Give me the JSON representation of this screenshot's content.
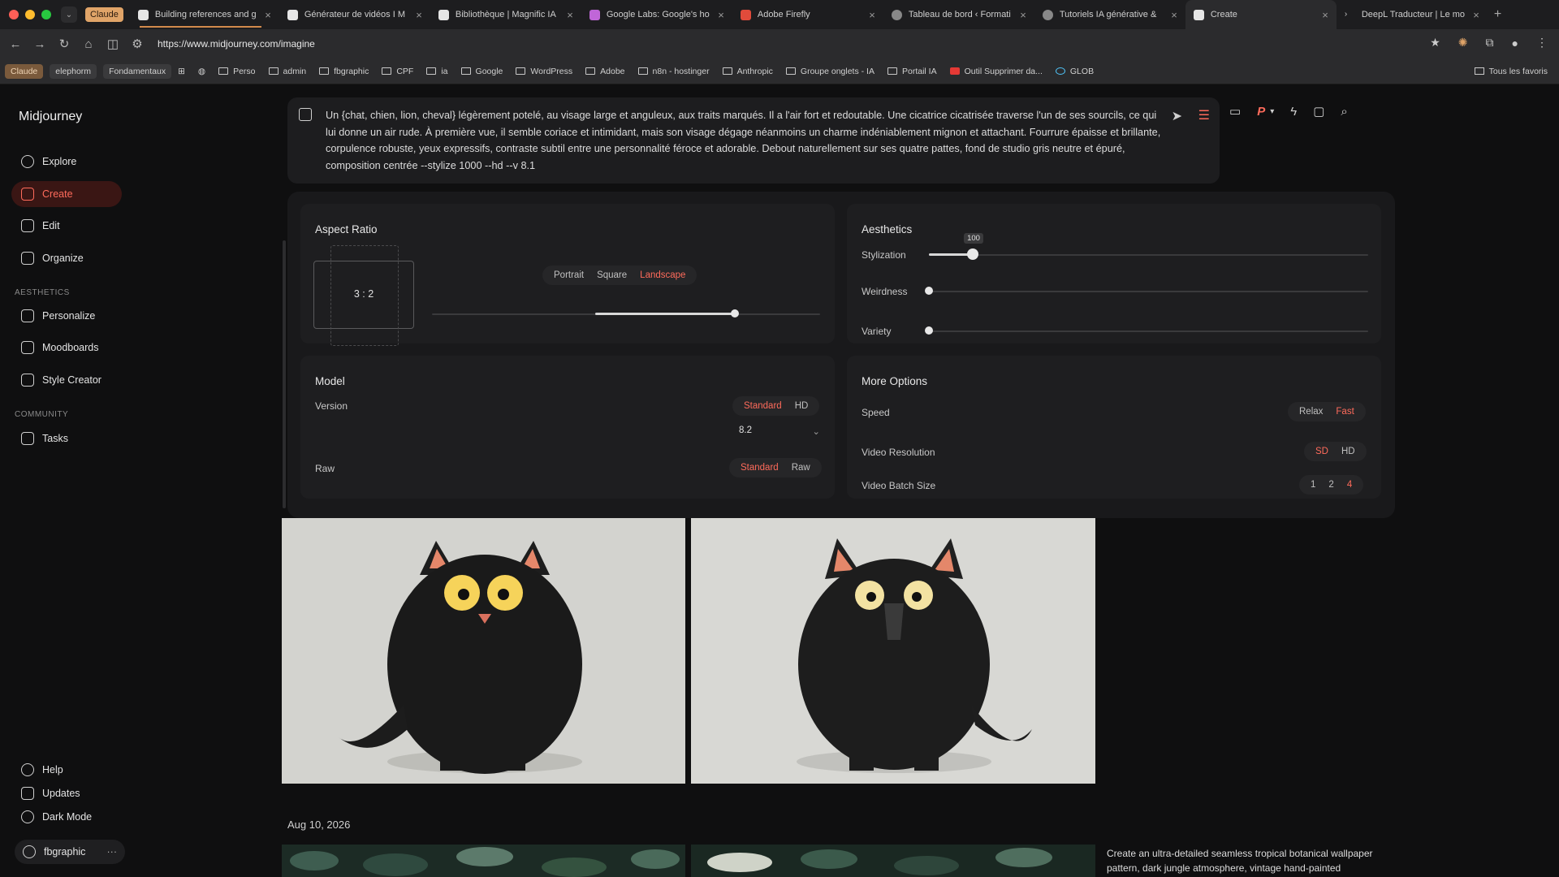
{
  "browser": {
    "claude_pill": "Claude",
    "tabs": [
      {
        "title": "Building references and g"
      },
      {
        "title": "Générateur de vidéos I M"
      },
      {
        "title": "Bibliothèque | Magnific IA"
      },
      {
        "title": "Google Labs: Google's ho"
      },
      {
        "title": "Adobe Firefly"
      },
      {
        "title": "Tableau de bord ‹ Formati"
      },
      {
        "title": "Tutoriels IA générative &"
      },
      {
        "title": "Create"
      },
      {
        "title": "DeepL Traducteur | Le mo"
      }
    ],
    "url": "https://www.midjourney.com/imagine",
    "bookmarks": [
      "Perso",
      "admin",
      "fbgraphic",
      "CPF",
      "ia",
      "Google",
      "WordPress",
      "Adobe",
      "n8n - hostinger",
      "Anthropic",
      "Groupe onglets - IA",
      "Portail IA",
      "Outil Supprimer da...",
      "GLOB"
    ],
    "bookmark_chips": [
      "Claude",
      "elephorm",
      "Fondamentaux"
    ],
    "all_favorites": "Tous les favoris"
  },
  "sidebar": {
    "brand": "Midjourney",
    "nav": [
      {
        "label": "Explore"
      },
      {
        "label": "Create"
      },
      {
        "label": "Edit"
      },
      {
        "label": "Organize"
      }
    ],
    "aesthetics_header": "AESTHETICS",
    "aesthetics": [
      {
        "label": "Personalize"
      },
      {
        "label": "Moodboards"
      },
      {
        "label": "Style Creator"
      }
    ],
    "community_header": "COMMUNITY",
    "community": [
      {
        "label": "Tasks"
      }
    ],
    "bottom": [
      {
        "label": "Help"
      },
      {
        "label": "Updates"
      },
      {
        "label": "Dark Mode"
      }
    ],
    "user": "fbgraphic",
    "user_more": "···"
  },
  "prompt": {
    "text": "Un {chat, chien, lion, cheval} légèrement potelé, au visage large et anguleux, aux traits marqués. Il a l'air fort et redoutable. Une cicatrice cicatrisée traverse l'un de ses sourcils, ce qui lui donne un air rude. À première vue, il semble coriace et intimidant, mais son visage dégage néanmoins un charme indéniablement mignon et attachant. Fourrure épaisse et brillante, corpulence robuste, yeux expressifs, contraste subtil entre une personnalité féroce et adorable. Debout naturellement sur ses quatre pattes, fond de studio gris neutre et épuré, composition centrée --stylize 1000 --hd --v 8.1"
  },
  "topbar": {
    "p_label": "P"
  },
  "aspect_ratio": {
    "title": "Aspect Ratio",
    "ratio": "3 : 2",
    "options": [
      "Portrait",
      "Square",
      "Landscape"
    ],
    "selected": "Landscape",
    "slider_fraction": 0.78
  },
  "aesthetics": {
    "title": "Aesthetics",
    "stylization": {
      "label": "Stylization",
      "value": "100",
      "fraction": 0.1
    },
    "weirdness": {
      "label": "Weirdness",
      "fraction": 0.0
    },
    "variety": {
      "label": "Variety",
      "fraction": 0.0
    }
  },
  "model": {
    "title": "Model",
    "version_label": "Version",
    "modes": [
      "Standard",
      "HD"
    ],
    "mode_selected": "Standard",
    "version_value": "8.2",
    "raw_label": "Raw",
    "raw_options": [
      "Standard",
      "Raw"
    ],
    "raw_selected": "Standard"
  },
  "more_options": {
    "title": "More Options",
    "speed_label": "Speed",
    "speed_options": [
      "Relax",
      "Fast"
    ],
    "speed_selected": "Fast",
    "video_res_label": "Video Resolution",
    "video_res_options": [
      "SD",
      "HD"
    ],
    "video_res_selected": "SD",
    "batch_label": "Video Batch Size",
    "batch_options": [
      "1",
      "2",
      "4"
    ],
    "batch_selected": "4"
  },
  "feed": {
    "date": "Aug 10, 2026",
    "caption": "Create an ultra-detailed seamless tropical botanical wallpaper pattern, dark jungle atmosphere, vintage hand-painted"
  },
  "colors": {
    "accent": "#ff6b5b",
    "active_bg": "#3a1614",
    "panel": "#19191b"
  }
}
